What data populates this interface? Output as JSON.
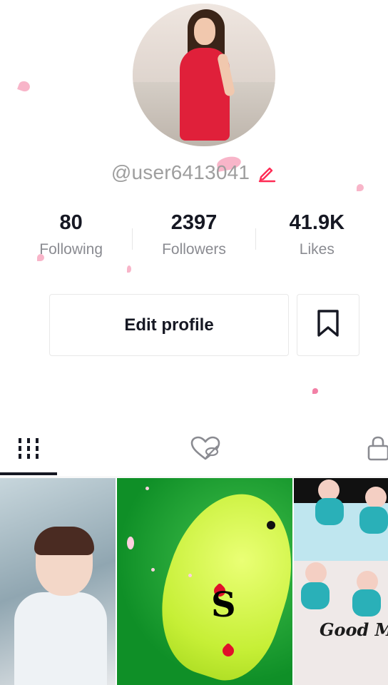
{
  "profile": {
    "username": "@user6413041"
  },
  "stats": [
    {
      "value": "80",
      "label": "Following"
    },
    {
      "value": "2397",
      "label": "Followers"
    },
    {
      "value": "41.9K",
      "label": "Likes"
    }
  ],
  "actions": {
    "edit_profile_label": "Edit profile"
  },
  "tabs": [
    {
      "name": "videos",
      "icon": "grid-icon",
      "active": true
    },
    {
      "name": "liked",
      "icon": "heart-hidden-icon",
      "active": false
    },
    {
      "name": "private",
      "icon": "lock-icon",
      "active": false
    }
  ],
  "thumbnails": [
    {
      "subject": "child-photo"
    },
    {
      "subject": "green-parrot",
      "overlay_text": "S"
    },
    {
      "subject": "cake-dolls",
      "overlay_text": "Good M"
    }
  ],
  "colors": {
    "accent": "#fe2c55",
    "text_primary": "#161823",
    "text_secondary": "#8a8b91"
  }
}
